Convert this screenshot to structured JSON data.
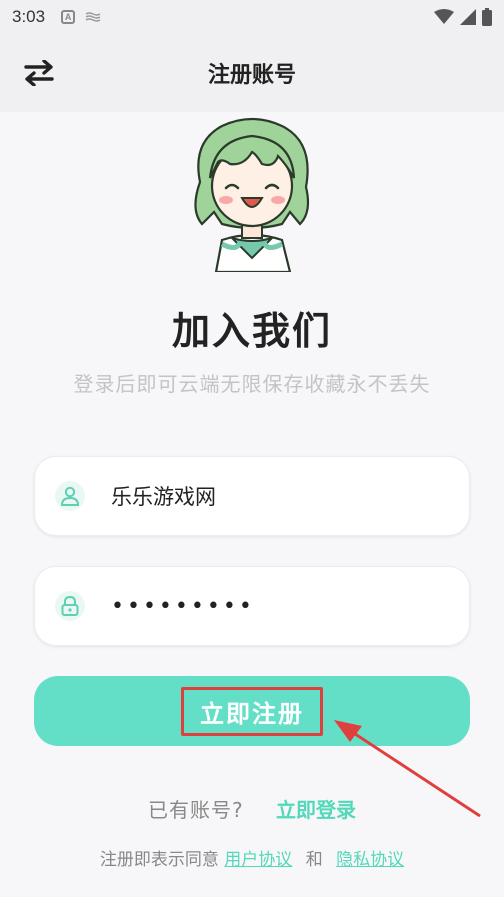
{
  "status_bar": {
    "time": "3:03",
    "a_icon_letter": "A"
  },
  "header": {
    "title": "注册账号",
    "switch_icon": "swap-arrows-icon"
  },
  "hero": {
    "avatar_icon": "anime-girl-avatar",
    "title": "加入我们",
    "subtitle": "登录后即可云端无限保存收藏永不丢失"
  },
  "form": {
    "username": {
      "value": "乐乐游戏网",
      "icon": "user-icon"
    },
    "password": {
      "value": "•••••••••",
      "icon": "lock-icon"
    },
    "submit_label": "立即注册"
  },
  "footer": {
    "have_account": "已有账号?",
    "login_link": "立即登录",
    "agree_prefix": "注册即表示同意",
    "user_agreement": "用户协议",
    "and": "和",
    "privacy_policy": "隐私协议"
  },
  "colors": {
    "accent": "#64dfc7",
    "link": "#53d8b9",
    "highlight_box": "#e0403d"
  }
}
